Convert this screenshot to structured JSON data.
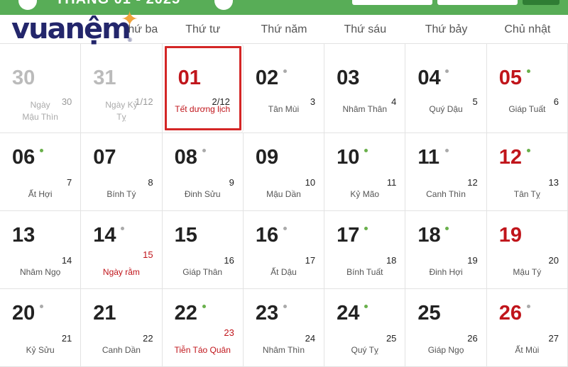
{
  "header": {
    "title": "THÁNG 01 - 2025",
    "weekdays": [
      "Thứ ba",
      "Thứ tư",
      "Thứ năm",
      "Thứ sáu",
      "Thứ bảy",
      "Chủ nhật"
    ]
  },
  "logo": {
    "text": "vuanệm"
  },
  "colors": {
    "accent": "#58ad57",
    "sunday": "#c0151b",
    "dot_green": "#6ab04c",
    "dot_gray": "#aaaaaa"
  },
  "weeks": [
    [
      {
        "d": "30",
        "l": "30",
        "n": "Ngày Mậu Thìn",
        "past": true
      },
      {
        "d": "31",
        "l": "1/12",
        "n": "Ngày Kỷ Tỵ",
        "past": true
      },
      {
        "d": "01",
        "l": "2/12",
        "n": "Tết dương lịch",
        "red": true,
        "sel": true
      },
      {
        "d": "02",
        "l": "3",
        "n": "Tân Mùi",
        "dot": "gray"
      },
      {
        "d": "03",
        "l": "4",
        "n": "Nhâm Thân"
      },
      {
        "d": "04",
        "l": "5",
        "n": "Quý Dậu",
        "dot": "gray"
      },
      {
        "d": "05",
        "l": "6",
        "n": "Giáp Tuất",
        "dot": "green",
        "sun": true
      }
    ],
    [
      {
        "d": "06",
        "l": "7",
        "n": "Ất Hợi",
        "dot": "green"
      },
      {
        "d": "07",
        "l": "8",
        "n": "Bính Tý"
      },
      {
        "d": "08",
        "l": "9",
        "n": "Đinh Sửu",
        "dot": "gray"
      },
      {
        "d": "09",
        "l": "10",
        "n": "Mậu Dần"
      },
      {
        "d": "10",
        "l": "11",
        "n": "Kỷ Mão",
        "dot": "green"
      },
      {
        "d": "11",
        "l": "12",
        "n": "Canh Thìn",
        "dot": "gray"
      },
      {
        "d": "12",
        "l": "13",
        "n": "Tân Tỵ",
        "dot": "green",
        "sun": true
      }
    ],
    [
      {
        "d": "13",
        "l": "14",
        "n": "Nhâm Ngọ"
      },
      {
        "d": "14",
        "l": "15",
        "n": "Ngày rằm",
        "dot": "gray",
        "redl": true
      },
      {
        "d": "15",
        "l": "16",
        "n": "Giáp Thân"
      },
      {
        "d": "16",
        "l": "17",
        "n": "Ất Dậu",
        "dot": "gray"
      },
      {
        "d": "17",
        "l": "18",
        "n": "Bính Tuất",
        "dot": "green"
      },
      {
        "d": "18",
        "l": "19",
        "n": "Đinh Hợi",
        "dot": "green"
      },
      {
        "d": "19",
        "l": "20",
        "n": "Mậu Tý",
        "sun": true
      }
    ],
    [
      {
        "d": "20",
        "l": "21",
        "n": "Kỷ Sửu",
        "dot": "gray"
      },
      {
        "d": "21",
        "l": "22",
        "n": "Canh Dần"
      },
      {
        "d": "22",
        "l": "23",
        "n": "Tiễn Táo Quân",
        "dot": "green",
        "redl": true
      },
      {
        "d": "23",
        "l": "24",
        "n": "Nhâm Thìn",
        "dot": "gray"
      },
      {
        "d": "24",
        "l": "25",
        "n": "Quý Tỵ",
        "dot": "green"
      },
      {
        "d": "25",
        "l": "26",
        "n": "Giáp Ngọ"
      },
      {
        "d": "26",
        "l": "27",
        "n": "Ất Mùi",
        "dot": "gray",
        "sun": true
      }
    ]
  ]
}
